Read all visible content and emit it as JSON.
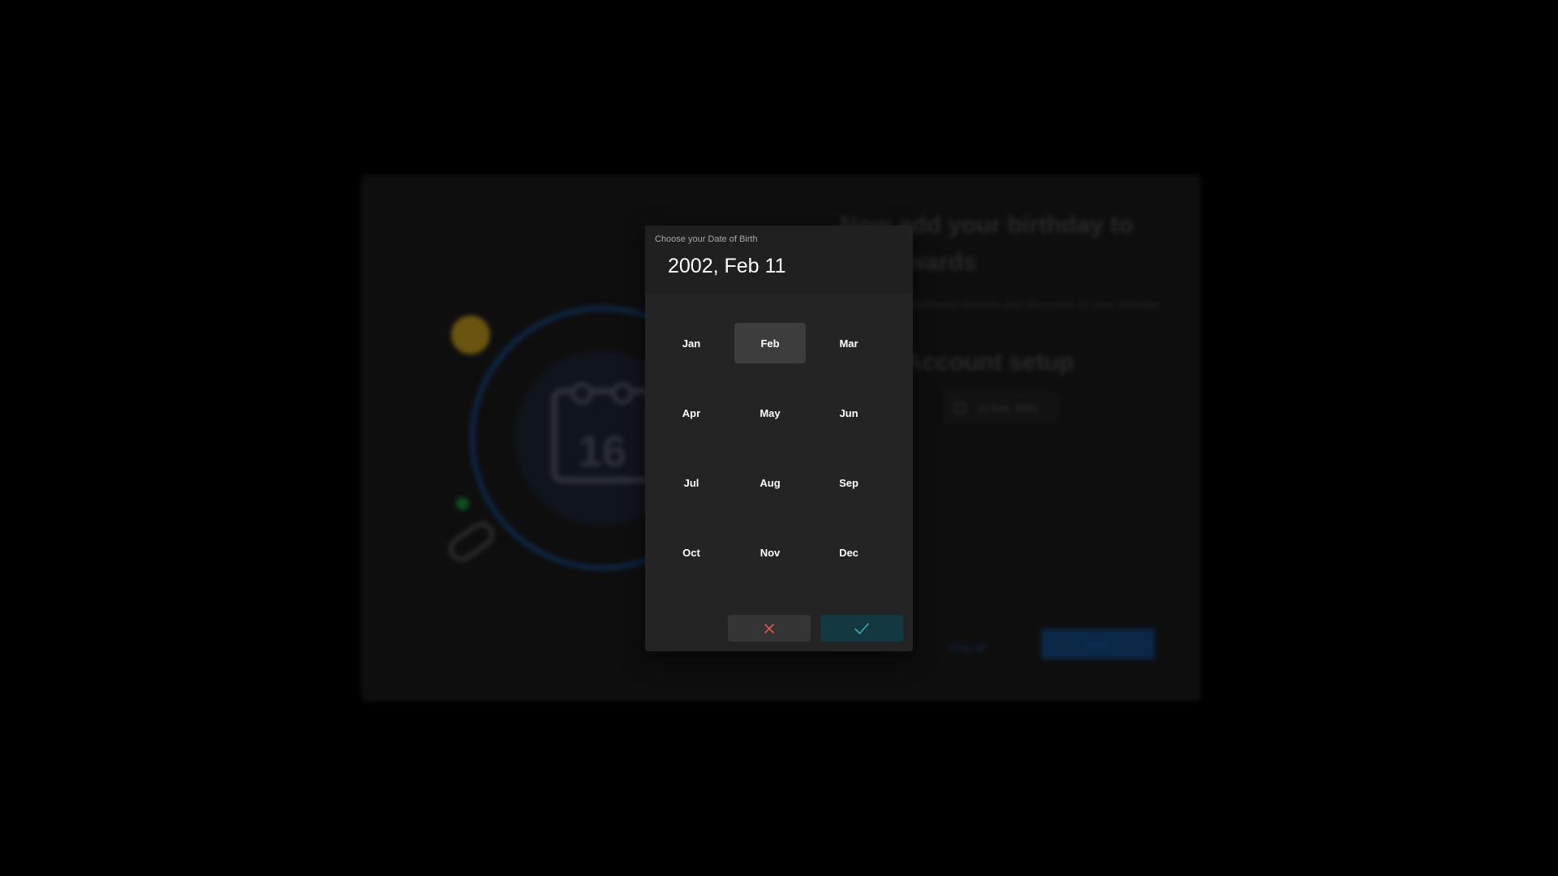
{
  "colors": {
    "page_background": "#000000",
    "dialog_background": "#242424",
    "selected_month_background": "#3d3d3d",
    "cancel_icon": "#e05555",
    "confirm_icon": "#3fa7b8",
    "confirm_button_background": "#14383f"
  },
  "background_screen": {
    "heading": "Now add your birthday to get rewards",
    "description": "to receive additional rewards and discounts on your birthday.",
    "section_heading": "Account setup",
    "date_field_value": "11 Feb, 2002",
    "skip_label": "Skip all",
    "next_label": "Next",
    "illustration_day": "16",
    "illustration_icons": [
      "calendar-icon",
      "coin-icon",
      "link-icon",
      "dot-icon"
    ]
  },
  "date_picker": {
    "subtitle": "Choose your Date of Birth",
    "selected_date": "2002, Feb 11",
    "selected_month": "Feb",
    "months": [
      "Jan",
      "Feb",
      "Mar",
      "Apr",
      "May",
      "Jun",
      "Jul",
      "Aug",
      "Sep",
      "Oct",
      "Nov",
      "Dec"
    ],
    "actions": {
      "cancel_icon": "close-icon",
      "confirm_icon": "check-icon"
    }
  }
}
